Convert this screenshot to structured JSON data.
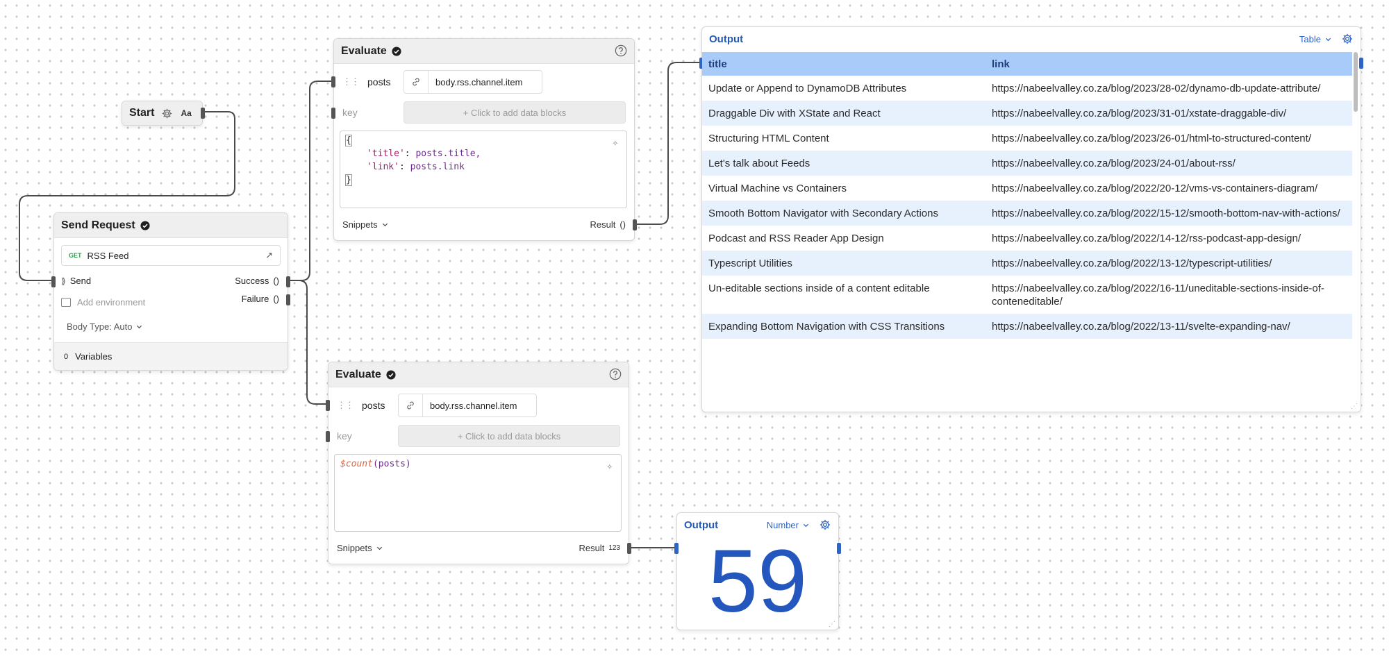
{
  "start_node": {
    "title": "Start",
    "type_badge": "Aa"
  },
  "send_request": {
    "title": "Send Request",
    "method": "GET",
    "request_name": "RSS Feed",
    "send_label": "Send",
    "success_label": "Success",
    "failure_label": "Failure",
    "result_marker": "()",
    "env_placeholder": "Add environment",
    "body_type": "Body Type: Auto",
    "variables_count": "0",
    "variables_label": "Variables"
  },
  "evaluate_top": {
    "title": "Evaluate",
    "param_name": "posts",
    "param_value": "body.rss.channel.item",
    "key_placeholder": "key",
    "add_block": "+ Click to add data blocks",
    "code": {
      "open": "{",
      "line1_key": "'title'",
      "line1_sep": ": ",
      "line1_val": "posts.title,",
      "line2_key": "'link'",
      "line2_sep": ": ",
      "line2_val": "posts.link",
      "close": "}"
    },
    "snippets_label": "Snippets",
    "result_label": "Result",
    "result_marker": "()"
  },
  "evaluate_bottom": {
    "title": "Evaluate",
    "param_name": "posts",
    "param_value": "body.rss.channel.item",
    "key_placeholder": "key",
    "add_block": "+ Click to add data blocks",
    "code": {
      "fn": "$count",
      "args": "(posts)"
    },
    "snippets_label": "Snippets",
    "result_label": "Result",
    "result_marker": "123"
  },
  "output_table": {
    "title": "Output",
    "view_mode": "Table",
    "columns": [
      "title",
      "link"
    ],
    "rows": [
      {
        "title": "Update or Append to DynamoDB Attributes",
        "link": "https://nabeelvalley.co.za/blog/2023/28-02/dynamo-db-update-attribute/"
      },
      {
        "title": "Draggable Div with XState and React",
        "link": "https://nabeelvalley.co.za/blog/2023/31-01/xstate-draggable-div/"
      },
      {
        "title": "Structuring HTML Content",
        "link": "https://nabeelvalley.co.za/blog/2023/26-01/html-to-structured-content/"
      },
      {
        "title": "Let's talk about Feeds",
        "link": "https://nabeelvalley.co.za/blog/2023/24-01/about-rss/"
      },
      {
        "title": "Virtual Machine vs Containers",
        "link": "https://nabeelvalley.co.za/blog/2022/20-12/vms-vs-containers-diagram/"
      },
      {
        "title": "Smooth Bottom Navigator with Secondary Actions",
        "link": "https://nabeelvalley.co.za/blog/2022/15-12/smooth-bottom-nav-with-actions/"
      },
      {
        "title": "Podcast and RSS Reader App Design",
        "link": "https://nabeelvalley.co.za/blog/2022/14-12/rss-podcast-app-design/"
      },
      {
        "title": "Typescript Utilities",
        "link": "https://nabeelvalley.co.za/blog/2022/13-12/typescript-utilities/"
      },
      {
        "title": "Un-editable sections inside of a content editable",
        "link": "https://nabeelvalley.co.za/blog/2022/16-11/uneditable-sections-inside-of-conteneditable/"
      },
      {
        "title": "Expanding Bottom Navigation with CSS Transitions",
        "link": "https://nabeelvalley.co.za/blog/2022/13-11/svelte-expanding-nav/"
      }
    ]
  },
  "output_number": {
    "title": "Output",
    "view_mode": "Number",
    "value": "59"
  },
  "colors": {
    "accent": "#2d64c6",
    "table_header": "#a9cbf9",
    "table_alt_row": "#e7f0fd",
    "get_method": "#2e9e4f"
  }
}
